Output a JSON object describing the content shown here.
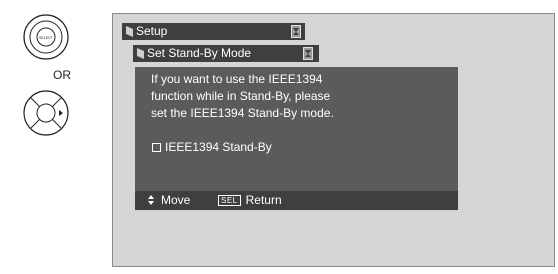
{
  "remote": {
    "select_button_text": "SELECT",
    "or_label": "OR"
  },
  "screen": {
    "menu_title": "Setup",
    "submenu_title": "Set Stand-By Mode",
    "message_lines": [
      "If you want to use the IEEE1394",
      "function while in Stand-By, please",
      "set the IEEE1394 Stand-By mode."
    ],
    "option_label": "IEEE1394 Stand-By",
    "option_checked": false,
    "footer": {
      "move_label": "Move",
      "sel_badge": "SEL",
      "return_label": "Return"
    }
  },
  "colors": {
    "menu_bar": "#3f3f3f",
    "dialog": "#5b5b5b",
    "screen_bg": "#d6d6d6"
  },
  "icons": {
    "select_remote": "select-button-icon",
    "arrow_remote": "dpad-right-icon",
    "updown": "updown-arrows-icon"
  }
}
